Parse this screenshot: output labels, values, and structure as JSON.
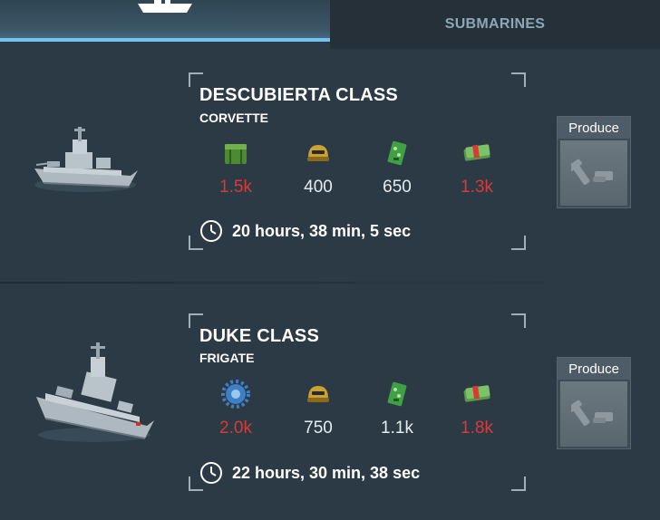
{
  "tabs": {
    "ships_icon": "ship-icon",
    "submarines_label": "SUBMARINES"
  },
  "ships": [
    {
      "name": "DESCUBIERTA CLASS",
      "class": "CORVETTE",
      "resources": [
        {
          "icon": "green-crate-icon",
          "value": "1.5k",
          "sufficient": false
        },
        {
          "icon": "gold-helmet-icon",
          "value": "400",
          "sufficient": true
        },
        {
          "icon": "circuit-board-icon",
          "value": "650",
          "sufficient": true
        },
        {
          "icon": "cash-stack-icon",
          "value": "1.3k",
          "sufficient": false
        }
      ],
      "build_time": "20 hours, 38 min, 5 sec",
      "produce_label": "Produce"
    },
    {
      "name": "DUKE CLASS",
      "class": "FRIGATE",
      "resources": [
        {
          "icon": "blue-gear-icon",
          "value": "2.0k",
          "sufficient": false
        },
        {
          "icon": "gold-helmet-icon",
          "value": "750",
          "sufficient": true
        },
        {
          "icon": "circuit-board-icon",
          "value": "1.1k",
          "sufficient": true
        },
        {
          "icon": "cash-stack-icon",
          "value": "1.8k",
          "sufficient": false
        }
      ],
      "build_time": "22 hours, 30 min, 38 sec",
      "produce_label": "Produce"
    }
  ],
  "colors": {
    "background": "#2b3a44",
    "tab_accent": "#6fc3ee",
    "insufficient": "#d83a36",
    "sufficient": "#e6ecf0"
  }
}
